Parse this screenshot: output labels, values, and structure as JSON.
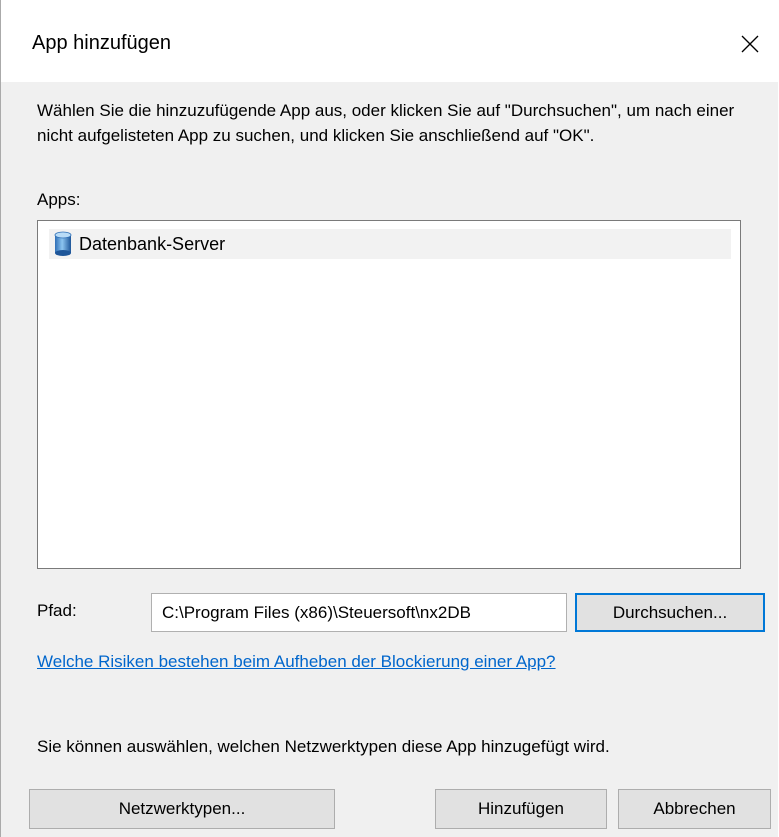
{
  "window": {
    "title": "App hinzufügen",
    "close_label": "✕"
  },
  "instructions": "Wählen Sie die hinzuzufügende App aus, oder klicken Sie auf \"Durchsuchen\", um nach einer nicht aufgelisteten App zu suchen, und klicken Sie anschließend auf \"OK\".",
  "apps": {
    "label": "Apps:",
    "items": [
      {
        "label": "Datenbank-Server",
        "icon": "database-server-icon"
      }
    ]
  },
  "path": {
    "label": "Pfad:",
    "value": "C:\\Program Files (x86)\\Steuersoft\\nx2DB"
  },
  "buttons": {
    "browse": "Durchsuchen...",
    "network_types": "Netzwerktypen...",
    "add": "Hinzufügen",
    "cancel": "Abbrechen"
  },
  "help_link": "Welche Risiken bestehen beim Aufheben der Blockierung einer App?",
  "network_info": "Sie können auswählen, welchen Netzwerktypen diese App hinzugefügt wird.",
  "colors": {
    "link": "#0066cc",
    "default_button_border": "#0078d7",
    "dialog_background": "#f0f0f0"
  }
}
